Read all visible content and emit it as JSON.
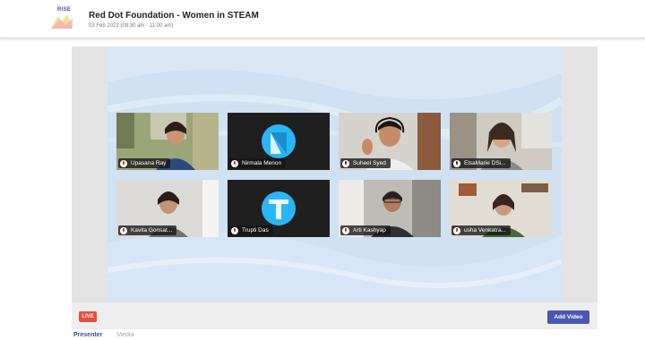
{
  "header": {
    "logo_text": "RISE",
    "title": "Red Dot Foundation - Women in STEAM",
    "datetime": "03 Feb 2023 (09:30 am - 11:00 am)"
  },
  "participants": [
    {
      "name": "Upasana Ray",
      "mic": "muted",
      "type": "video"
    },
    {
      "name": "Nirmala Menon",
      "mic": "muted",
      "type": "avatar"
    },
    {
      "name": "Suheel Syed",
      "mic": "active",
      "type": "video"
    },
    {
      "name": "ElsaMarie DSi...",
      "mic": "active",
      "type": "video"
    },
    {
      "name": "Kavita Gonsat...",
      "mic": "muted",
      "type": "video"
    },
    {
      "name": "Trupti Das",
      "mic": "muted",
      "type": "avatar"
    },
    {
      "name": "Arti Kashyap",
      "mic": "muted",
      "type": "video"
    },
    {
      "name": "usha Venkatra...",
      "mic": "muted",
      "type": "video"
    }
  ],
  "controls": {
    "live_label": "LIVE",
    "add_video_label": "Add Video"
  },
  "tabs": [
    {
      "label": "Presenter",
      "active": true
    },
    {
      "label": "Media",
      "active": false
    }
  ],
  "colors": {
    "accent": "#4a57b3",
    "live": "#e74c3c",
    "stage_bg": "#cfe1f2",
    "avatar_blue": "#29b6f6"
  }
}
